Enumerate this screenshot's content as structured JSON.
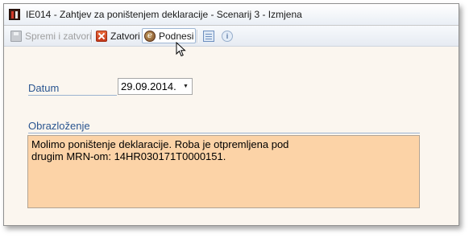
{
  "window": {
    "title": "IE014 - Zahtjev za poništenjem deklaracije - Scenarij 3 - Izmjena"
  },
  "toolbar": {
    "save_close_label": "Spremi i zatvori",
    "close_label": "Zatvori",
    "submit_label": "Podnesi",
    "submit_icon_glyph": "e"
  },
  "form": {
    "date_label": "Datum",
    "date_value": "29.09.2014.",
    "date_dropdown_glyph": "▼",
    "reason_label": "Obrazloženje",
    "reason_value": "Molimo poništenje deklaracije. Roba je otpremljena pod\ndrugim MRN-om: 14HR030171T0000151."
  },
  "colors": {
    "label_blue": "#2a5590",
    "reason_bg": "#fcd3a7",
    "window_bg": "#fbf6ef"
  },
  "icons": [
    "app-icon",
    "save-icon",
    "close-icon",
    "submit-icon",
    "document-icon",
    "info-icon"
  ]
}
